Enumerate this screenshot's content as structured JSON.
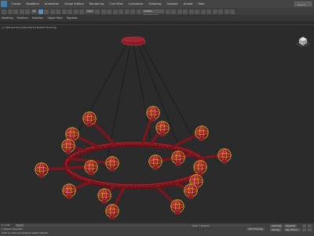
{
  "menubar": {
    "items": [
      "Create",
      "Modifiers",
      "Animation",
      "Graph Editors",
      "Rendering",
      "Civil View",
      "Customize",
      "Scripting",
      "Content",
      "Arnold",
      "Help"
    ],
    "search_placeholder": "Sign In"
  },
  "toolbar": {
    "selection_filter": "All",
    "view_dropdown": "View",
    "named_selection": "Create Selection Se"
  },
  "ribbon": {
    "tabs": [
      "Modeling",
      "Freeform",
      "Selection",
      "Object Paint",
      "Populate"
    ]
  },
  "viewport": {
    "label": "[+] [Perspective] [Standard] [Default Shading]"
  },
  "statusbar": {
    "frame_counter": "0 / 100",
    "selection_status": "1 Object Selected",
    "prompt": "Click or click-and-drag to select objects",
    "grid_label": "Grid = 10.0cm",
    "add_time_tag": "Add Time Tag",
    "auto_key": "Auto Key",
    "set_key": "Set Key",
    "selected_label": "Selected",
    "key_filters": "Key Filters..."
  },
  "colors": {
    "object": "#8b1a22",
    "object_edge": "#c7364a",
    "selection_bracket": "#d8c520",
    "viewport_bg": "#2b2b2b"
  }
}
